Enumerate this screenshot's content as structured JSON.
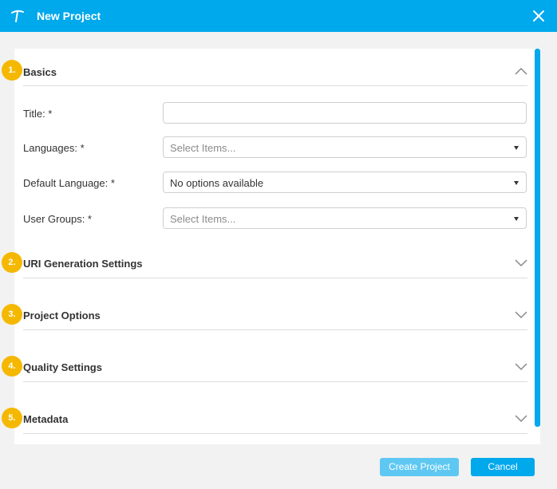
{
  "window": {
    "title": "New Project"
  },
  "sections": [
    {
      "number": "1.",
      "title": "Basics",
      "expanded": true
    },
    {
      "number": "2.",
      "title": "URI Generation Settings",
      "expanded": false
    },
    {
      "number": "3.",
      "title": "Project Options",
      "expanded": false
    },
    {
      "number": "4.",
      "title": "Quality Settings",
      "expanded": false
    },
    {
      "number": "5.",
      "title": "Metadata",
      "expanded": false
    }
  ],
  "basics": {
    "title_label": "Title: *",
    "title_value": "",
    "languages_label": "Languages: *",
    "languages_placeholder": "Select Items...",
    "default_language_label": "Default Language: *",
    "default_language_value": "No options available",
    "user_groups_label": "User Groups: *",
    "user_groups_placeholder": "Select Items..."
  },
  "footer": {
    "create_label": "Create Project",
    "cancel_label": "Cancel"
  },
  "colors": {
    "accent": "#00a8ec",
    "badge": "#f5b800",
    "create_disabled": "#5ec8f2"
  }
}
